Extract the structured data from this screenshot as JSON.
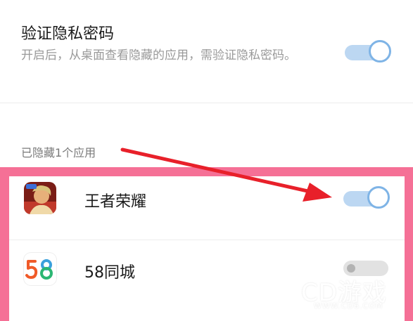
{
  "privacy_setting": {
    "title": "验证隐私密码",
    "description": "开启后，从桌面查看隐藏的应用，需验证隐私密码。",
    "enabled": true
  },
  "hidden_section": {
    "label": "已隐藏1个应用"
  },
  "apps": [
    {
      "name": "王者荣耀",
      "icon": "honor-of-kings-icon",
      "hidden": true
    },
    {
      "name": "58同城",
      "icon": "58-tongcheng-icon",
      "hidden": false
    }
  ],
  "colors": {
    "toggle_on_track": "#bcd7f2",
    "toggle_on_ring": "#7fb4e6",
    "highlight_frame": "#f57096",
    "arrow": "#e8202a"
  },
  "watermark": {
    "text": "CD游戏",
    "sub": "WWW.CD6.COM"
  }
}
